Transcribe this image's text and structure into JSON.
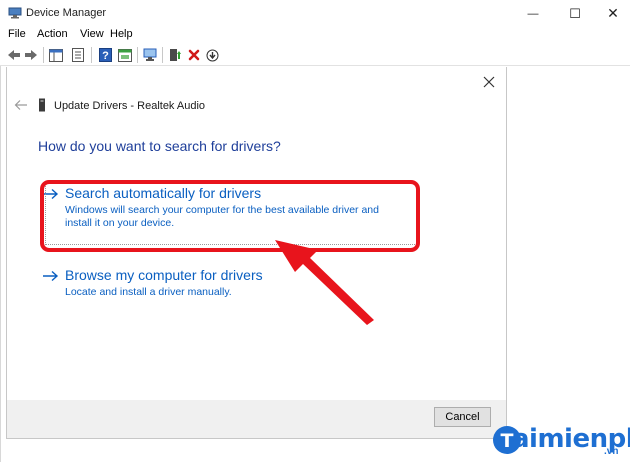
{
  "window": {
    "title": "Device Manager",
    "minimize_symbol": "—",
    "maximize_symbol": "☐",
    "close_symbol": "✕"
  },
  "menu": [
    "File",
    "Action",
    "View",
    "Help"
  ],
  "toolbar": {
    "buttons": [
      "back-icon",
      "forward-icon",
      "show-hide-console-tree-icon",
      "properties-icon",
      "help-icon",
      "action-pane-icon",
      "scan-hardware-icon",
      "update-driver-icon",
      "uninstall-icon",
      "disable-device-icon"
    ]
  },
  "dialog": {
    "title": "Update Drivers - Realtek Audio",
    "heading": "How do you want to search for drivers?",
    "option_auto": {
      "title": "Search automatically for drivers",
      "description": "Windows will search your computer for the best available driver and install it on your device."
    },
    "option_browse": {
      "title": "Browse my computer for drivers",
      "description": "Locate and install a driver manually."
    },
    "cancel_label": "Cancel"
  },
  "annotation": {
    "highlight_color": "#e8141c"
  },
  "watermark": {
    "text": "aimienphi",
    "suffix": ".vn"
  },
  "colors": {
    "link": "#0a5fc1",
    "heading": "#1f3f9a",
    "brand": "#1e6fd2"
  }
}
